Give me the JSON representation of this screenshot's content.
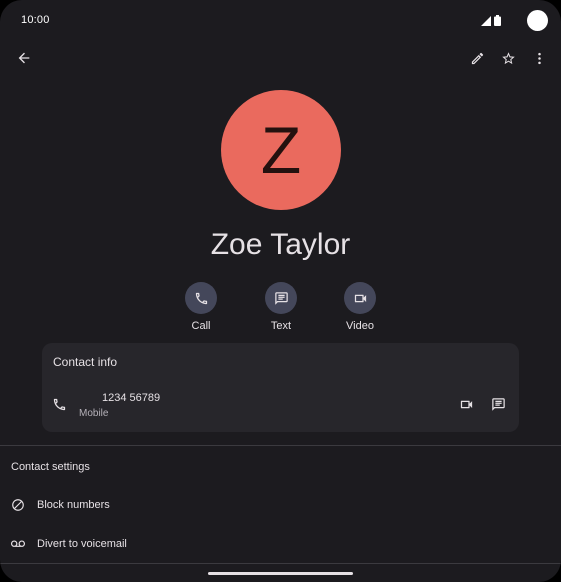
{
  "status_bar": {
    "time": "10:00"
  },
  "top_bar": {
    "icons": [
      "arrow-back-icon",
      "pencil-icon",
      "star-icon",
      "more-vert-icon"
    ]
  },
  "contact": {
    "initial": "Z",
    "name": "Zoe Taylor",
    "avatar_color": "#ea6a5e"
  },
  "actions": [
    {
      "label": "Call",
      "icon": "phone-icon"
    },
    {
      "label": "Text",
      "icon": "message-icon"
    },
    {
      "label": "Video",
      "icon": "videocam-icon"
    }
  ],
  "contact_info": {
    "title": "Contact info",
    "phone": {
      "number": "1234 56789",
      "type": "Mobile"
    }
  },
  "contact_settings": {
    "title": "Contact settings",
    "items": [
      {
        "label": "Block numbers",
        "icon": "block-icon"
      },
      {
        "label": "Divert to voicemail",
        "icon": "voicemail-icon"
      }
    ]
  },
  "colors": {
    "background": "#1c1b1f",
    "card": "#27262b",
    "action_circle": "#44475a",
    "text": "#e6e1e5"
  }
}
